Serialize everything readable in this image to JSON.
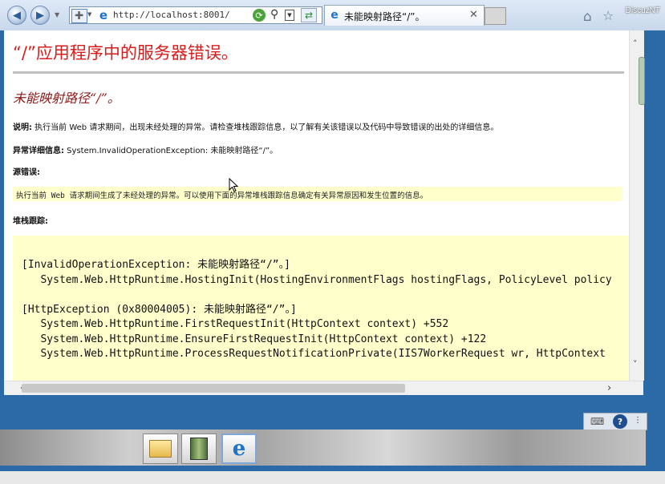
{
  "browser": {
    "url": "http://localhost:8001/",
    "tab_title": "未能映射路径“/”。",
    "brand": "DiscuzNT"
  },
  "page": {
    "heading": "“/”应用程序中的服务器错误。",
    "subheading": "未能映射路径“/”。",
    "description_label": "说明:",
    "description_text": " 执行当前 Web 请求期间，出现未经处理的异常。请检查堆栈跟踪信息，以了解有关该错误以及代码中导致错误的出处的详细信息。",
    "exception_label": "异常详细信息:",
    "exception_text": " System.InvalidOperationException: 未能映射路径“/”。",
    "source_error_label": "源错误:",
    "source_error_text": "执行当前 Web 请求期间生成了未经处理的异常。可以使用下面的异常堆栈跟踪信息确定有关异常原因和发生位置的信息。",
    "stack_trace_label": "堆栈跟踪:",
    "stack_trace": "[InvalidOperationException: 未能映射路径“/”。]\n   System.Web.HttpRuntime.HostingInit(HostingEnvironmentFlags hostingFlags, PolicyLevel policy\n\n[HttpException (0x80004005): 未能映射路径“/”。]\n   System.Web.HttpRuntime.FirstRequestInit(HttpContext context) +552\n   System.Web.HttpRuntime.EnsureFirstRequestInit(HttpContext context) +122\n   System.Web.HttpRuntime.ProcessRequestNotificationPrivate(IIS7WorkerRequest wr, HttpContext"
  },
  "colors": {
    "heading_red": "#d71e1e",
    "subheading_red": "#8b1a1a",
    "highlight_yellow": "#ffffcc",
    "taskbar_blue": "#2b6aa6"
  },
  "icons": {
    "back": "back-arrow-icon",
    "forward": "forward-arrow-icon",
    "refresh": "refresh-icon",
    "search": "search-icon",
    "home": "home-icon",
    "favorites": "star-icon",
    "tools": "gear-icon"
  }
}
